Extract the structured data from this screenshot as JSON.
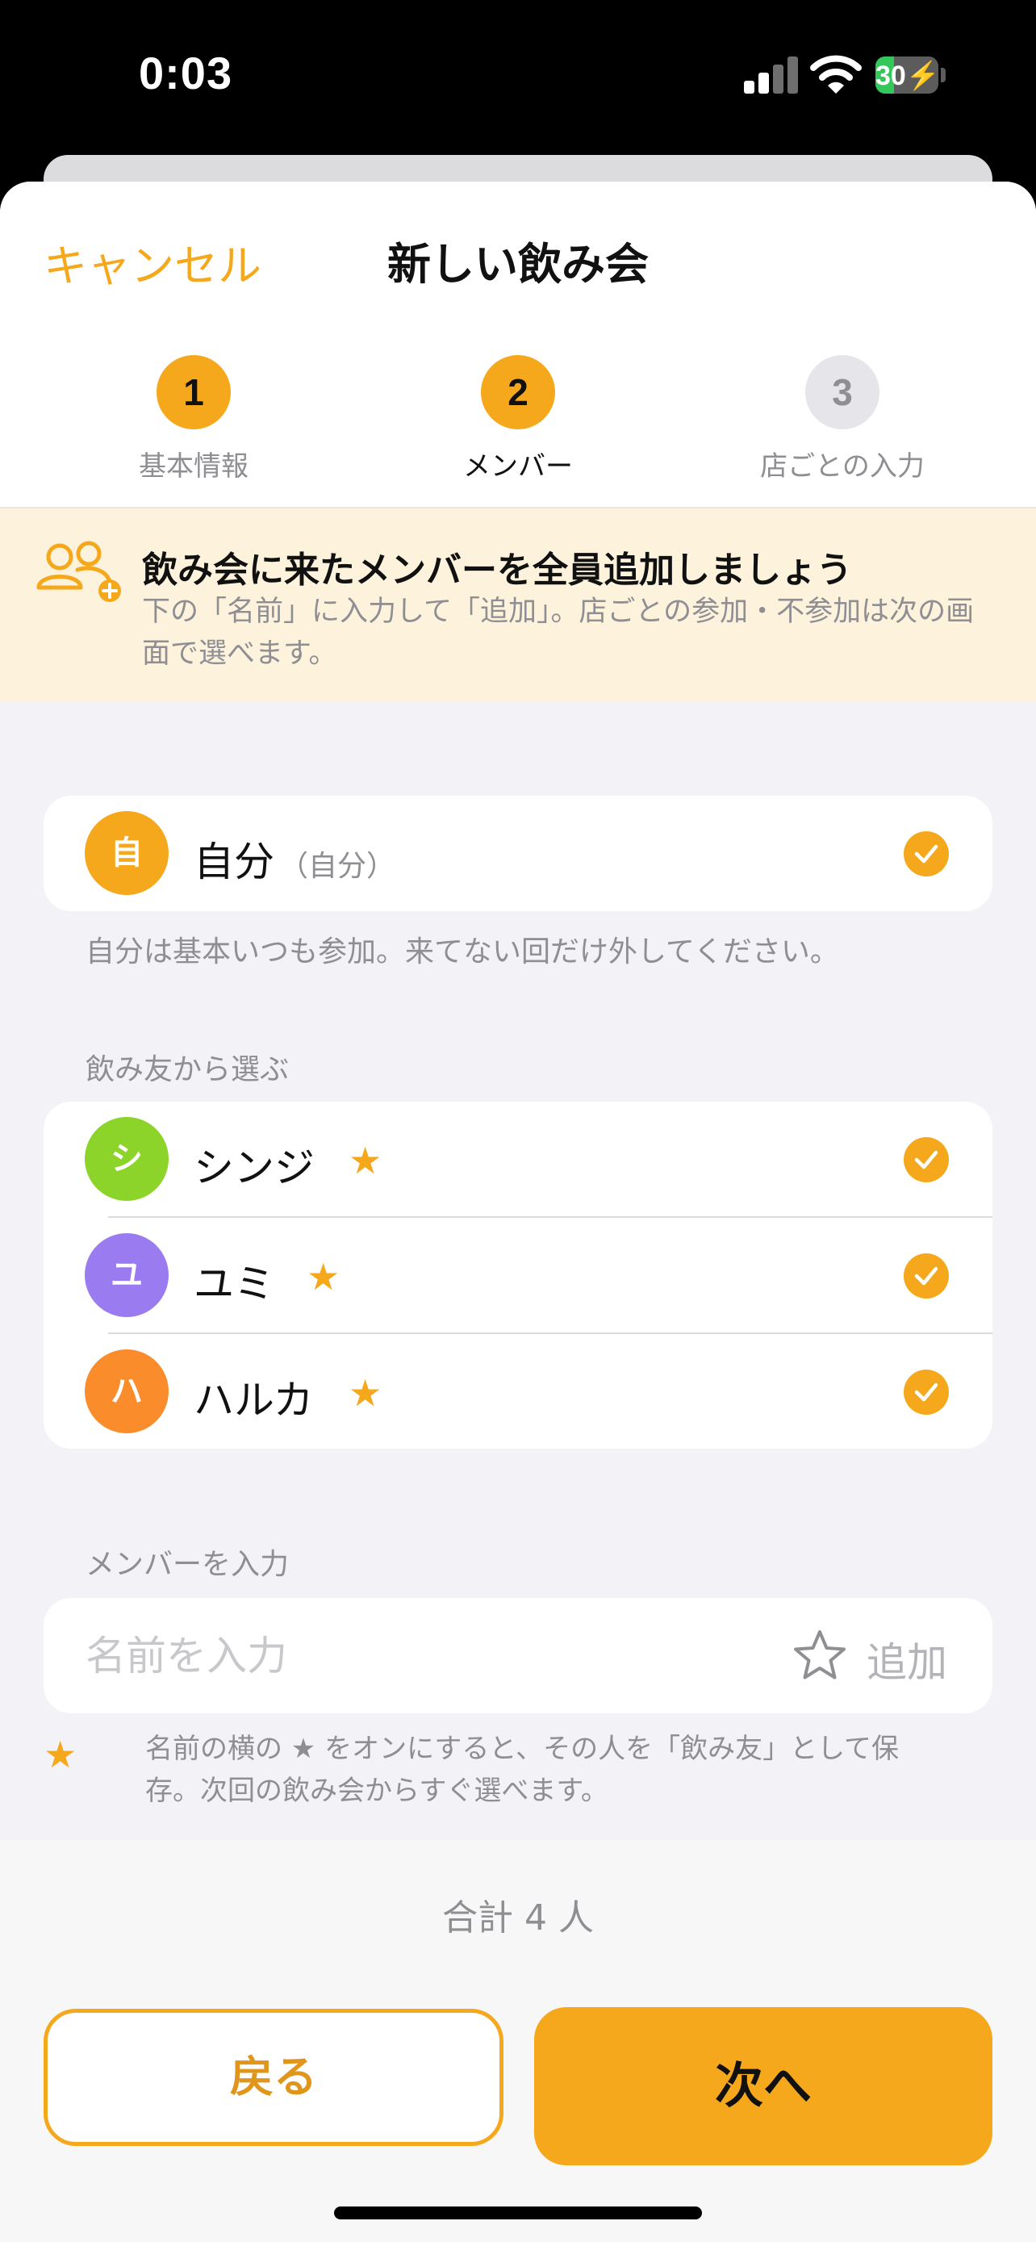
{
  "status_bar": {
    "time": "0:03",
    "battery": "30"
  },
  "nav": {
    "cancel_label": "キャンセル",
    "title": "新しい飲み会"
  },
  "steps": [
    {
      "number": "1",
      "label": "基本情報",
      "state": "done"
    },
    {
      "number": "2",
      "label": "メンバー",
      "state": "current"
    },
    {
      "number": "3",
      "label": "店ごとの入力",
      "state": "upcoming"
    }
  ],
  "banner": {
    "icon": "add-people-icon",
    "title": "飲み会に来たメンバーを全員追加しましょう",
    "text": "下の「名前」に入力して「追加」。店ごとの参加・不参加は次の画面で選べます。"
  },
  "self": {
    "initial": "自",
    "name": "自分",
    "tag": "（自分）",
    "checked": true,
    "color": "#f5a81c",
    "note": "自分は基本いつも参加。来てない回だけ外してください。"
  },
  "friends": {
    "section_label": "飲み友から選ぶ",
    "items": [
      {
        "initial": "シ",
        "name": "シンジ",
        "favorite": true,
        "checked": true,
        "color": "#8cd42a"
      },
      {
        "initial": "ユ",
        "name": "ユミ",
        "favorite": true,
        "checked": true,
        "color": "#9b7bf0"
      },
      {
        "initial": "ハ",
        "name": "ハルカ",
        "favorite": true,
        "checked": true,
        "color": "#fb8c2b"
      }
    ]
  },
  "member_input": {
    "section_label": "メンバーを入力",
    "placeholder": "名前を入力",
    "value": "",
    "star_on": false,
    "add_label": "追加",
    "hint": "名前の横の ★ をオンにすると、その人を「飲み友」として保存。次回の飲み会からすぐ選べます。"
  },
  "footer": {
    "total": "合計 4 人",
    "back_label": "戻る",
    "next_label": "次へ"
  },
  "colors": {
    "accent": "#f5a81c",
    "banner_bg": "#fdf2dc",
    "background": "#f2f2f7"
  }
}
